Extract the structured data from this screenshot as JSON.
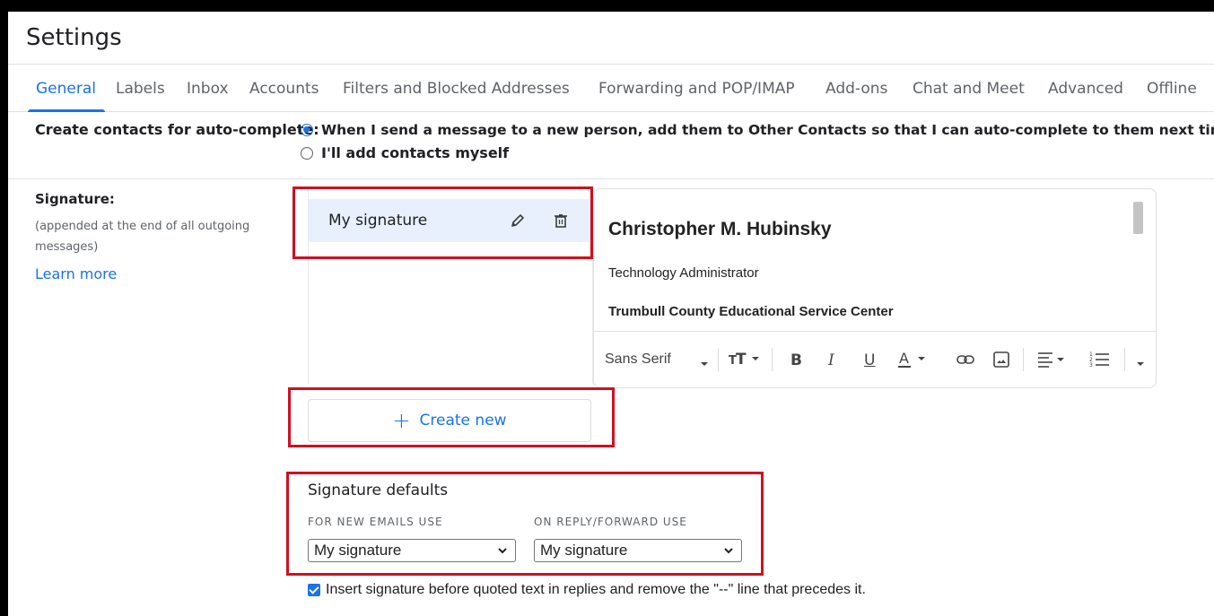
{
  "header": {
    "title": "Settings"
  },
  "tabs": [
    {
      "label": "General",
      "active": true
    },
    {
      "label": "Labels"
    },
    {
      "label": "Inbox"
    },
    {
      "label": "Accounts"
    },
    {
      "label": "Filters and Blocked Addresses"
    },
    {
      "label": "Forwarding and POP/IMAP"
    },
    {
      "label": "Add-ons"
    },
    {
      "label": "Chat and Meet"
    },
    {
      "label": "Advanced"
    },
    {
      "label": "Offline"
    }
  ],
  "autocomplete": {
    "label": "Create contacts for auto-complete:",
    "options": [
      {
        "text": "When I send a message to a new person, add them to Other Contacts so that I can auto-complete to them next time",
        "checked": true
      },
      {
        "text": "I'll add contacts myself",
        "checked": false
      }
    ]
  },
  "signature": {
    "label": "Signature:",
    "description": "(appended at the end of all outgoing messages)",
    "learn_more": "Learn more",
    "list": [
      {
        "name": "My signature"
      }
    ],
    "create_new": "Create new",
    "editor": {
      "name": "Christopher M. Hubinsky",
      "role": "Technology Administrator",
      "org": "Trumbull County Educational Service Center"
    },
    "toolbar": {
      "font": "Sans Serif"
    }
  },
  "defaults": {
    "title": "Signature defaults",
    "new_label": "FOR NEW EMAILS USE",
    "new_value": "My signature",
    "reply_label": "ON REPLY/FORWARD USE",
    "reply_value": "My signature"
  },
  "insert_option": {
    "text": "Insert signature before quoted text in replies and remove the \"--\" line that precedes it.",
    "checked": true
  },
  "colors": {
    "accent": "#1a73e8",
    "highlight": "#d0101f",
    "selected_bg": "#e8f0fe"
  },
  "icons": [
    "pencil-icon",
    "trash-icon",
    "plus-icon",
    "text-size-icon",
    "bold-icon",
    "italic-icon",
    "underline-icon",
    "text-color-icon",
    "link-icon",
    "image-icon",
    "align-icon",
    "numbered-list-icon",
    "chevron-down-icon"
  ]
}
